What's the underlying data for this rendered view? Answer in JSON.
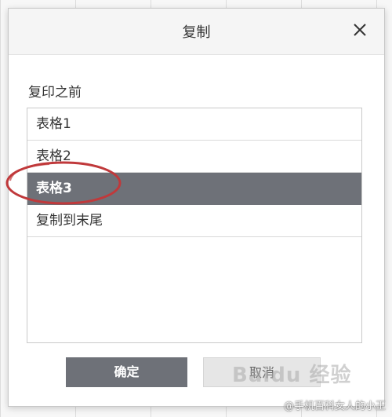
{
  "dialog": {
    "title": "复制",
    "close_icon": "close-icon",
    "section_label": "复印之前",
    "items": [
      {
        "label": "表格1",
        "selected": false
      },
      {
        "label": "表格2",
        "selected": false
      },
      {
        "label": "表格3",
        "selected": true
      },
      {
        "label": "复制到末尾",
        "selected": false
      }
    ],
    "ok_label": "确定",
    "cancel_label": "取消"
  },
  "watermark": {
    "logo_text": "Baidu 经验",
    "credit": "@手机百科女人的小王"
  },
  "colors": {
    "selected_bg": "#6e7178",
    "highlight_circle": "#c0393b"
  }
}
